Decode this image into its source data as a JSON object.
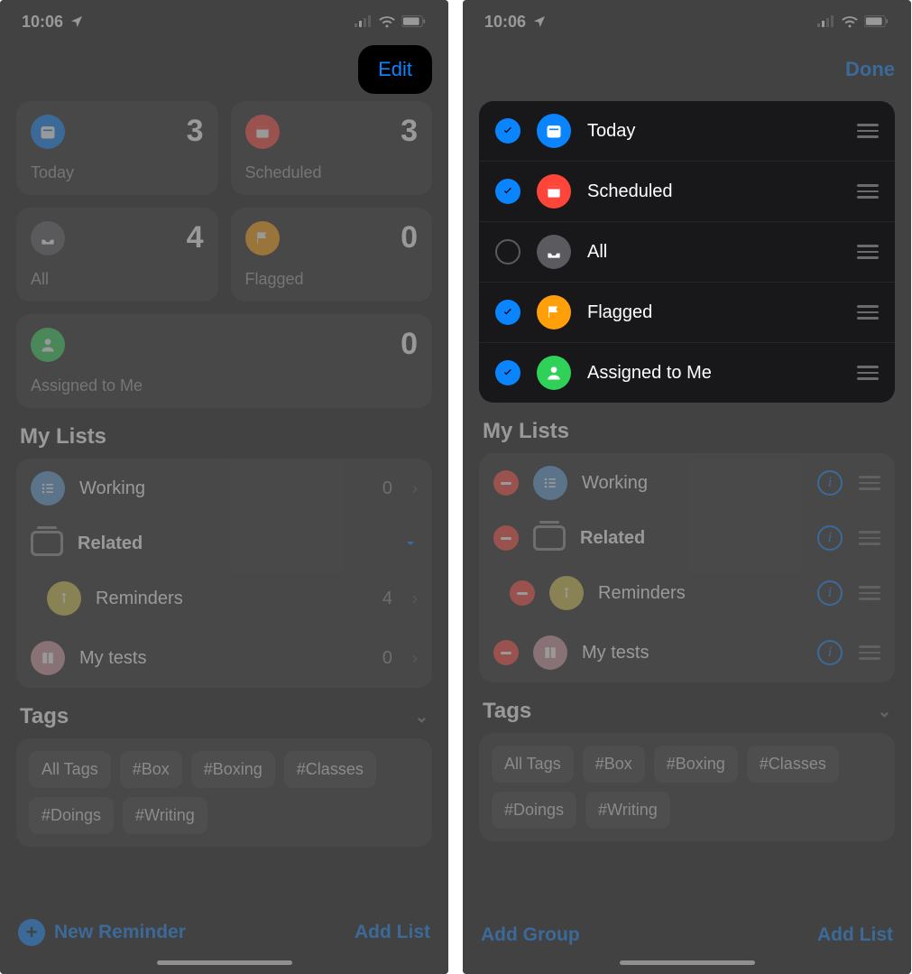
{
  "status": {
    "time": "10:06"
  },
  "left": {
    "edit_label": "Edit",
    "cards": {
      "today": {
        "label": "Today",
        "count": "3"
      },
      "scheduled": {
        "label": "Scheduled",
        "count": "3"
      },
      "all": {
        "label": "All",
        "count": "4"
      },
      "flagged": {
        "label": "Flagged",
        "count": "0"
      },
      "assigned": {
        "label": "Assigned to Me",
        "count": "0"
      }
    },
    "mylists_title": "My Lists",
    "lists": {
      "working": {
        "label": "Working",
        "count": "0"
      },
      "related": {
        "label": "Related"
      },
      "reminders": {
        "label": "Reminders",
        "count": "4"
      },
      "mytests": {
        "label": "My tests",
        "count": "0"
      }
    },
    "tags_title": "Tags",
    "tags": [
      "All Tags",
      "#Box",
      "#Boxing",
      "#Classes",
      "#Doings",
      "#Writing"
    ],
    "new_reminder": "New Reminder",
    "add_list": "Add List"
  },
  "right": {
    "done_label": "Done",
    "smart": [
      {
        "label": "Today",
        "checked": true,
        "color": "c-blue",
        "icon": "calendar-today"
      },
      {
        "label": "Scheduled",
        "checked": true,
        "color": "c-red",
        "icon": "calendar"
      },
      {
        "label": "All",
        "checked": false,
        "color": "c-gray",
        "icon": "tray"
      },
      {
        "label": "Flagged",
        "checked": true,
        "color": "c-orange",
        "icon": "flag"
      },
      {
        "label": "Assigned to Me",
        "checked": true,
        "color": "c-green",
        "icon": "person"
      }
    ],
    "mylists_title": "My Lists",
    "lists": [
      {
        "label": "Working",
        "color": "c-lblue",
        "icon": "list"
      },
      {
        "label": "Related",
        "color": "",
        "icon": "folder"
      },
      {
        "label": "Reminders",
        "color": "c-yellow",
        "icon": "dot"
      },
      {
        "label": "My tests",
        "color": "c-pink",
        "icon": "book"
      }
    ],
    "tags_title": "Tags",
    "tags": [
      "All Tags",
      "#Box",
      "#Boxing",
      "#Classes",
      "#Doings",
      "#Writing"
    ],
    "add_group": "Add Group",
    "add_list": "Add List"
  }
}
